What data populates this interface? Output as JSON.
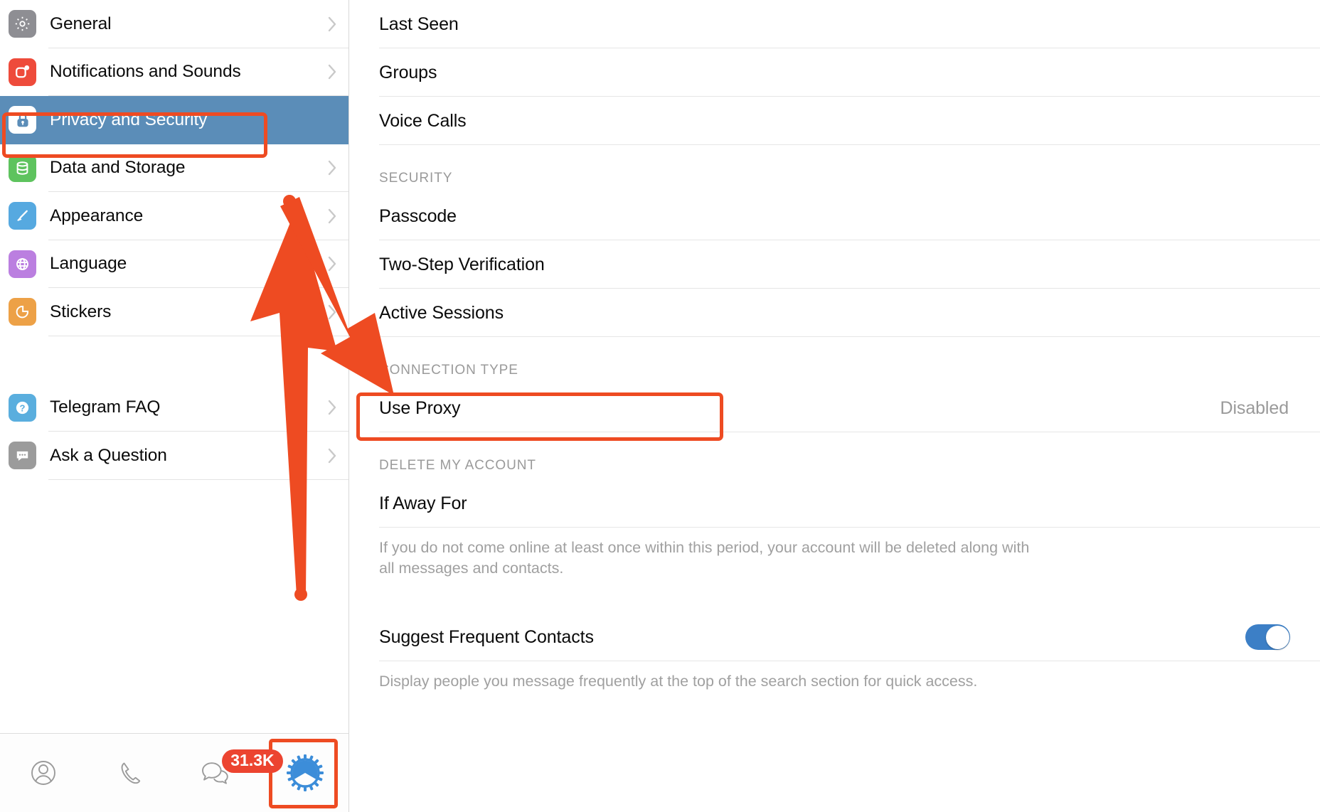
{
  "sidebar": {
    "items": [
      {
        "label": "General",
        "icon": "gear-icon",
        "color": "#8e8e93",
        "chevron": true
      },
      {
        "label": "Notifications and Sounds",
        "icon": "bell-notification-icon",
        "color": "#ee4b3b",
        "chevron": true
      },
      {
        "label": "Privacy and Security",
        "icon": "lock-icon",
        "color": "#ffffff",
        "chevron": false,
        "selected": true
      },
      {
        "label": "Data and Storage",
        "icon": "database-icon",
        "color": "#5ec35e",
        "chevron": true
      },
      {
        "label": "Appearance",
        "icon": "paintbrush-icon",
        "color": "#56a9e0",
        "chevron": true
      },
      {
        "label": "Language",
        "icon": "globe-icon",
        "color": "#bb7fe0",
        "chevron": true
      },
      {
        "label": "Stickers",
        "icon": "sticker-icon",
        "color": "#eda147",
        "chevron": true
      }
    ],
    "help_items": [
      {
        "label": "Telegram FAQ",
        "icon": "question-mark-icon",
        "color": "#5aaede",
        "chevron": true
      },
      {
        "label": "Ask a Question",
        "icon": "chat-bubble-icon",
        "color": "#9b9b9b",
        "chevron": true
      }
    ]
  },
  "tabbar": {
    "items": [
      {
        "name": "contacts-tab",
        "icon": "person-circle-icon"
      },
      {
        "name": "calls-tab",
        "icon": "phone-icon"
      },
      {
        "name": "chats-tab",
        "icon": "chat-bubbles-icon",
        "badge": "31.3K"
      },
      {
        "name": "settings-tab",
        "icon": "gear-settings-icon",
        "highlighted": true
      }
    ]
  },
  "main": {
    "privacy_rows": [
      {
        "label": "Last Seen"
      },
      {
        "label": "Groups"
      },
      {
        "label": "Voice Calls"
      }
    ],
    "security": {
      "header": "SECURITY",
      "rows": [
        {
          "label": "Passcode"
        },
        {
          "label": "Two-Step Verification"
        },
        {
          "label": "Active Sessions"
        }
      ]
    },
    "connection": {
      "header": "CONNECTION TYPE",
      "row": {
        "label": "Use Proxy",
        "value": "Disabled",
        "highlighted": true
      }
    },
    "delete_account": {
      "header": "DELETE MY ACCOUNT",
      "row": {
        "label": "If Away For"
      },
      "description": "If you do not come online at least once within this period, your account will be deleted along with all messages and contacts."
    },
    "frequent_contacts": {
      "label": "Suggest Frequent Contacts",
      "toggle_on": true,
      "description": "Display people you message frequently at the top of the search section for quick access."
    }
  },
  "annotation": {
    "highlight_color": "#ee4b22",
    "arrow_up_target": "settings-tab",
    "arrow_down_target": "use-proxy-row"
  }
}
